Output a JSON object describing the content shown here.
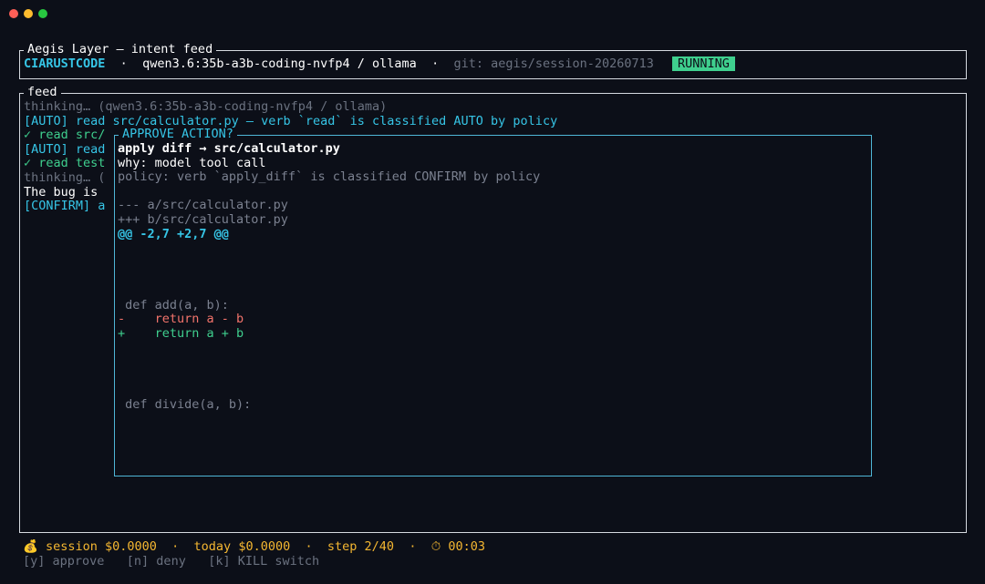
{
  "window": {
    "controls": [
      "close",
      "minimize",
      "maximize"
    ]
  },
  "header": {
    "title": "Aegis Layer — intent feed",
    "brand": "CIARUSTCODE",
    "sep": "·",
    "model": "qwen3.6:35b-a3b-coding-nvfp4 / ollama",
    "git": "git: aegis/session-20260713",
    "status": "RUNNING"
  },
  "feed": {
    "title": "feed",
    "lines": [
      {
        "text": "thinking… (qwen3.6:35b-a3b-coding-nvfp4 / ollama)",
        "style": "dim"
      },
      {
        "text": "[AUTO] read src/calculator.py — verb `read` is classified AUTO by policy",
        "style": "cyan"
      },
      {
        "text": "✓ read src/",
        "style": "green"
      },
      {
        "text": "[AUTO] read",
        "style": "cyan"
      },
      {
        "text": "✓ read test",
        "style": "green"
      },
      {
        "text": "thinking… (",
        "style": "dim"
      },
      {
        "text": "The bug is ",
        "style": "white"
      },
      {
        "text": "[CONFIRM] a",
        "style": "cyan"
      }
    ]
  },
  "modal": {
    "title": "APPROVE ACTION?",
    "action": "apply diff → src/calculator.py",
    "why": "why: model tool call",
    "policy": "policy: verb `apply_diff` is classified CONFIRM by policy",
    "diff": [
      {
        "text": "",
        "style": "dim"
      },
      {
        "text": "--- a/src/calculator.py",
        "style": "dim"
      },
      {
        "text": "+++ b/src/calculator.py",
        "style": "dim"
      },
      {
        "text": "@@ -2,7 +2,7 @@",
        "style": "hunk"
      },
      {
        "text": "",
        "style": "dim"
      },
      {
        "text": "",
        "style": "dim"
      },
      {
        "text": "",
        "style": "dim"
      },
      {
        "text": "",
        "style": "dim"
      },
      {
        "text": " def add(a, b):",
        "style": "dim"
      },
      {
        "text": "-    return a - b",
        "style": "del"
      },
      {
        "text": "+    return a + b",
        "style": "add"
      },
      {
        "text": "",
        "style": "dim"
      },
      {
        "text": "",
        "style": "dim"
      },
      {
        "text": "",
        "style": "dim"
      },
      {
        "text": "",
        "style": "dim"
      },
      {
        "text": " def divide(a, b):",
        "style": "dim"
      }
    ]
  },
  "footer": {
    "money_icon": "💰",
    "session": "session $0.0000",
    "today": "today $0.0000",
    "step": "step 2/40",
    "timer_icon": "⏱",
    "timer": "00:03",
    "sep": "·",
    "approve": "[y] approve",
    "deny": "[n] deny",
    "kill": "[k] KILL switch"
  }
}
